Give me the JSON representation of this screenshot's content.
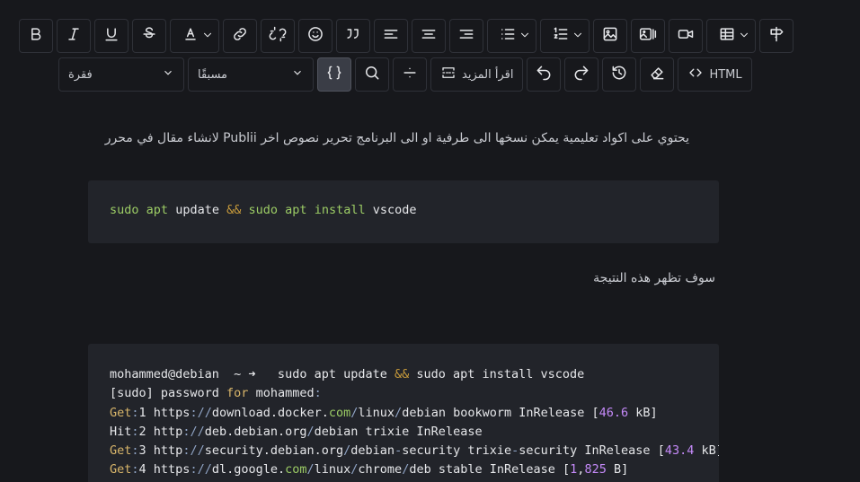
{
  "toolbar": {
    "row1": [
      {
        "name": "bold-button",
        "icon": "bold-icon"
      },
      {
        "name": "italic-button",
        "icon": "italic-icon"
      },
      {
        "name": "underline-button",
        "icon": "underline-icon"
      },
      {
        "name": "strikethrough-button",
        "icon": "strikethrough-icon"
      },
      {
        "name": "font-color-button",
        "icon": "font-color-icon"
      },
      {
        "name": "link-button",
        "icon": "link-icon"
      },
      {
        "name": "unlink-button",
        "icon": "unlink-icon"
      },
      {
        "name": "emoji-button",
        "icon": "emoji-icon"
      },
      {
        "name": "blockquote-button",
        "icon": "quote-icon"
      },
      {
        "name": "align-left-button",
        "icon": "align-left-icon"
      },
      {
        "name": "align-center-button",
        "icon": "align-center-icon"
      },
      {
        "name": "align-right-button",
        "icon": "align-right-icon"
      },
      {
        "name": "bullet-list-button",
        "icon": "bullet-list-icon"
      },
      {
        "name": "numbered-list-button",
        "icon": "numbered-list-icon"
      },
      {
        "name": "image-button",
        "icon": "image-icon"
      },
      {
        "name": "gallery-button",
        "icon": "gallery-icon"
      },
      {
        "name": "video-button",
        "icon": "video-icon"
      },
      {
        "name": "table-button",
        "icon": "table-icon"
      },
      {
        "name": "direction-button",
        "icon": "signpost-icon"
      }
    ],
    "paragraph_select": "فقرة",
    "preset_select": "مسبقًا",
    "read_more_label": "اقرأ المزيد",
    "html_label": "HTML"
  },
  "content": {
    "paragraph1": "يحتوي على اكواد تعليمية يمكن نسخها الى طرفية او الى البرنامج تحرير نصوص اخر Publii لانشاء مقال في محرر",
    "code1": "sudo apt update && sudo apt install vscode",
    "paragraph2": "سوف تظهر هذه النتيجة",
    "code2_lines": [
      "mohammed@debian  ~ ➜   sudo apt update && sudo apt install vscode",
      "[sudo] password for mohammed:",
      "Get:1 https://download.docker.com/linux/debian bookworm InRelease [46.6 kB]",
      "Hit:2 http://deb.debian.org/debian trixie InRelease",
      "Get:3 http://security.debian.org/debian-security trixie-security InRelease [43.4 kB]",
      "Get:4 https://dl.google.com/linux/chrome/deb stable InRelease [1,825 B]"
    ]
  },
  "colors": {
    "background": "#17181c",
    "code_background": "#22242a",
    "keyword_green": "#9ccc65",
    "operator_orange": "#c79a3b",
    "number_purple": "#c58af9"
  }
}
